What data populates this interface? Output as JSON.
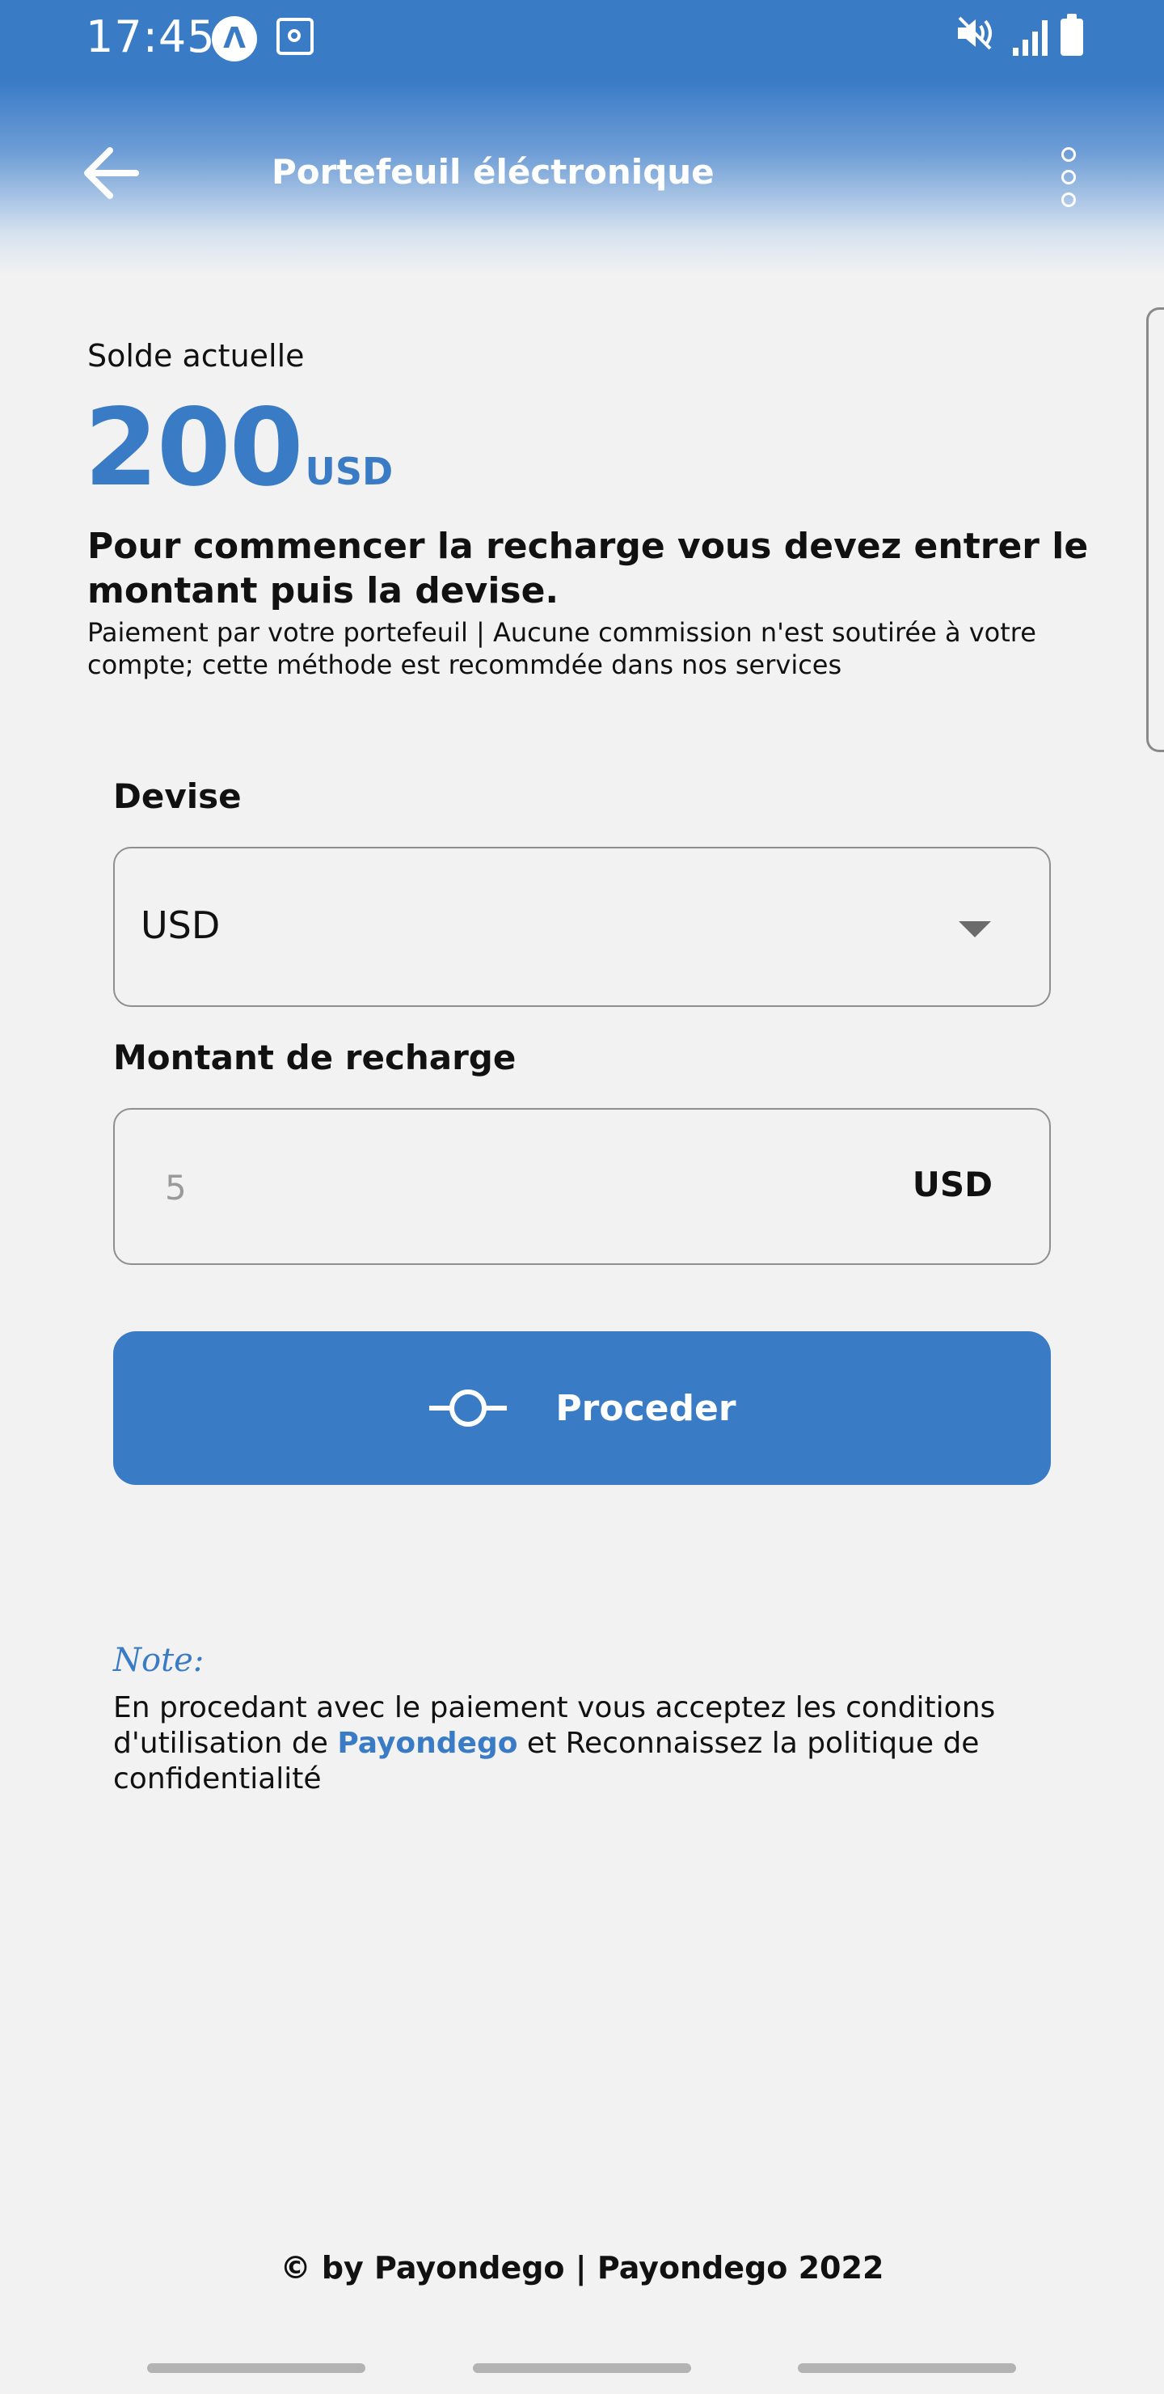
{
  "status_bar": {
    "time": "17:45",
    "app_icon_letter": "Λ",
    "icons": [
      "notification-a-icon",
      "safe-icon",
      "mute-icon",
      "signal-icon",
      "battery-icon"
    ]
  },
  "header": {
    "title": "Portefeuil éléctronique",
    "back_icon": "arrow-left-icon",
    "menu_icon": "more-vert-icon"
  },
  "balance": {
    "label": "Solde actuelle",
    "amount": "200",
    "currency": "USD"
  },
  "intro": {
    "title": "Pour commencer la recharge vous devez entrer le montant puis la devise.",
    "subtitle": "Paiement par votre portefeuil | Aucune commission n'est soutirée à votre compte; cette méthode est recommdée dans nos services"
  },
  "form": {
    "currency_label": "Devise",
    "currency_selected": "USD",
    "amount_label": "Montant de recharge",
    "amount_placeholder": "5",
    "amount_value": "",
    "amount_suffix": "USD",
    "submit_label": "Proceder",
    "submit_icon": "commit-icon"
  },
  "note": {
    "title": "Note:",
    "text_before": "En procedant avec le paiement vous acceptez les conditions d'utilisation de ",
    "link_text": "Payondego",
    "text_after": " et Reconnaissez la politique de confidentialité"
  },
  "footer": {
    "text": "© by Payondego | Payondego 2022"
  },
  "colors": {
    "primary": "#3a7bc6",
    "background": "#f2f2f2",
    "text": "#111111",
    "border": "#8f8f8f"
  }
}
